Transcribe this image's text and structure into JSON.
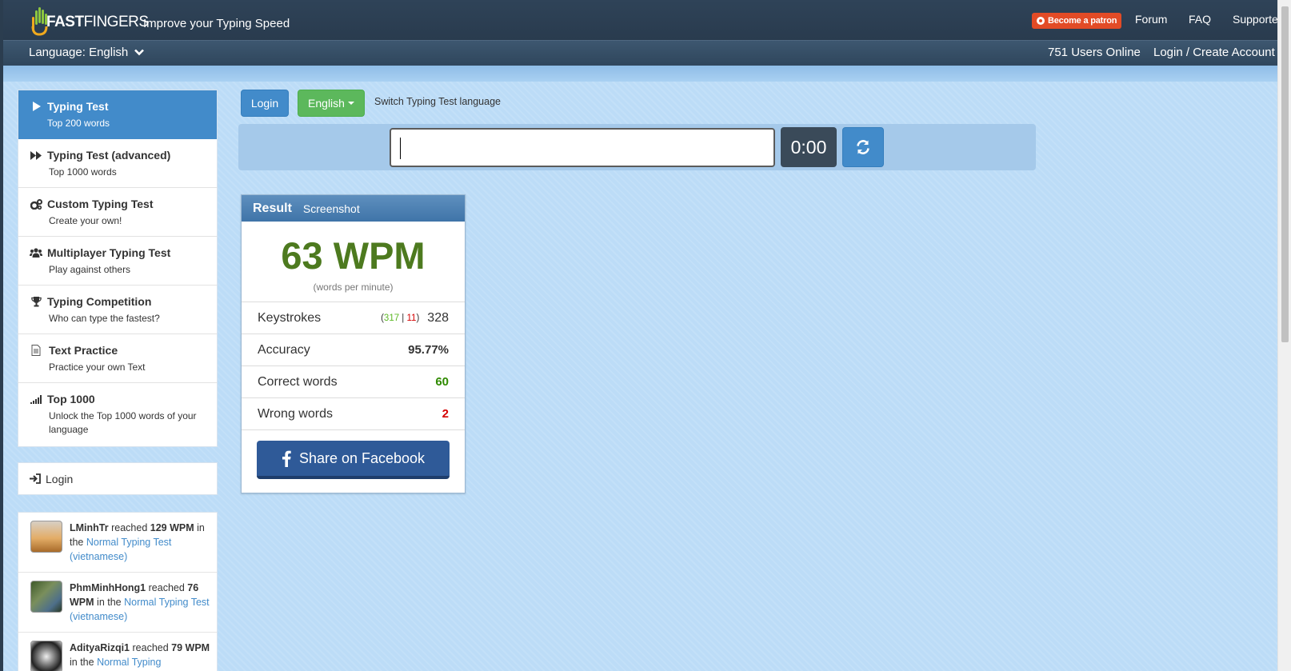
{
  "header": {
    "logo_text_bold": "FAST",
    "logo_text_light": "FINGERS",
    "tagline": "Improve your Typing Speed",
    "patron_label": "Become a patron",
    "nav": [
      "Forum",
      "FAQ",
      "Supporter"
    ],
    "language_label": "Language: English",
    "users_online": "751 Users Online",
    "login_create": "Login / Create Account"
  },
  "sidebar": {
    "items": [
      {
        "title": "Typing Test",
        "sub": "Top 200 words",
        "icon": "play-icon",
        "active": true
      },
      {
        "title": "Typing Test (advanced)",
        "sub": "Top 1000 words",
        "icon": "fast-forward-icon",
        "active": false
      },
      {
        "title": "Custom Typing Test",
        "sub": "Create your own!",
        "icon": "gears-icon",
        "active": false
      },
      {
        "title": "Multiplayer Typing Test",
        "sub": "Play against others",
        "icon": "users-icon",
        "active": false
      },
      {
        "title": "Typing Competition",
        "sub": "Who can type the fastest?",
        "icon": "trophy-icon",
        "active": false
      },
      {
        "title": "Text Practice",
        "sub": "Practice your own Text",
        "icon": "document-icon",
        "active": false
      },
      {
        "title": "Top 1000",
        "sub": "Unlock the Top 1000 words of your language",
        "icon": "signal-icon",
        "active": false
      }
    ],
    "login_label": "Login"
  },
  "feed": [
    {
      "user": "LMinhTr",
      "reached": "reached",
      "wpm": "129 WPM",
      "in_the": "in the",
      "test": "Normal Typing Test (vietnamese)"
    },
    {
      "user": "PhmMinhHong1",
      "reached": "reached",
      "wpm": "76 WPM",
      "in_the": "in the",
      "test": "Normal Typing Test (vietnamese)"
    },
    {
      "user": "AdityaRizqi1",
      "reached": "reached",
      "wpm": "79 WPM",
      "in_the": "in the",
      "test": "Normal Typing"
    }
  ],
  "controls": {
    "login_button": "Login",
    "language_button": "English",
    "switch_label": "Switch Typing Test language",
    "input_value": "",
    "timer": "0:00"
  },
  "result": {
    "title": "Result",
    "screenshot_label": "Screenshot",
    "wpm": "63 WPM",
    "wpm_sub": "(words per minute)",
    "keystrokes_label": "Keystrokes",
    "keystrokes_paren_open": "(",
    "keystrokes_correct": "317",
    "keystrokes_sep": " | ",
    "keystrokes_wrong": "11",
    "keystrokes_paren_close": ")",
    "keystrokes_total": "328",
    "accuracy_label": "Accuracy",
    "accuracy_value": "95.77%",
    "correct_label": "Correct words",
    "correct_value": "60",
    "wrong_label": "Wrong words",
    "wrong_value": "2",
    "share_label": "Share on Facebook"
  },
  "colors": {
    "header_bg": "#2f4358",
    "accent_blue": "#428bca",
    "english_green": "#5cb85c",
    "wpm_green": "#4d7a1f",
    "facebook": "#2f5a98",
    "patron": "#e24b26"
  }
}
